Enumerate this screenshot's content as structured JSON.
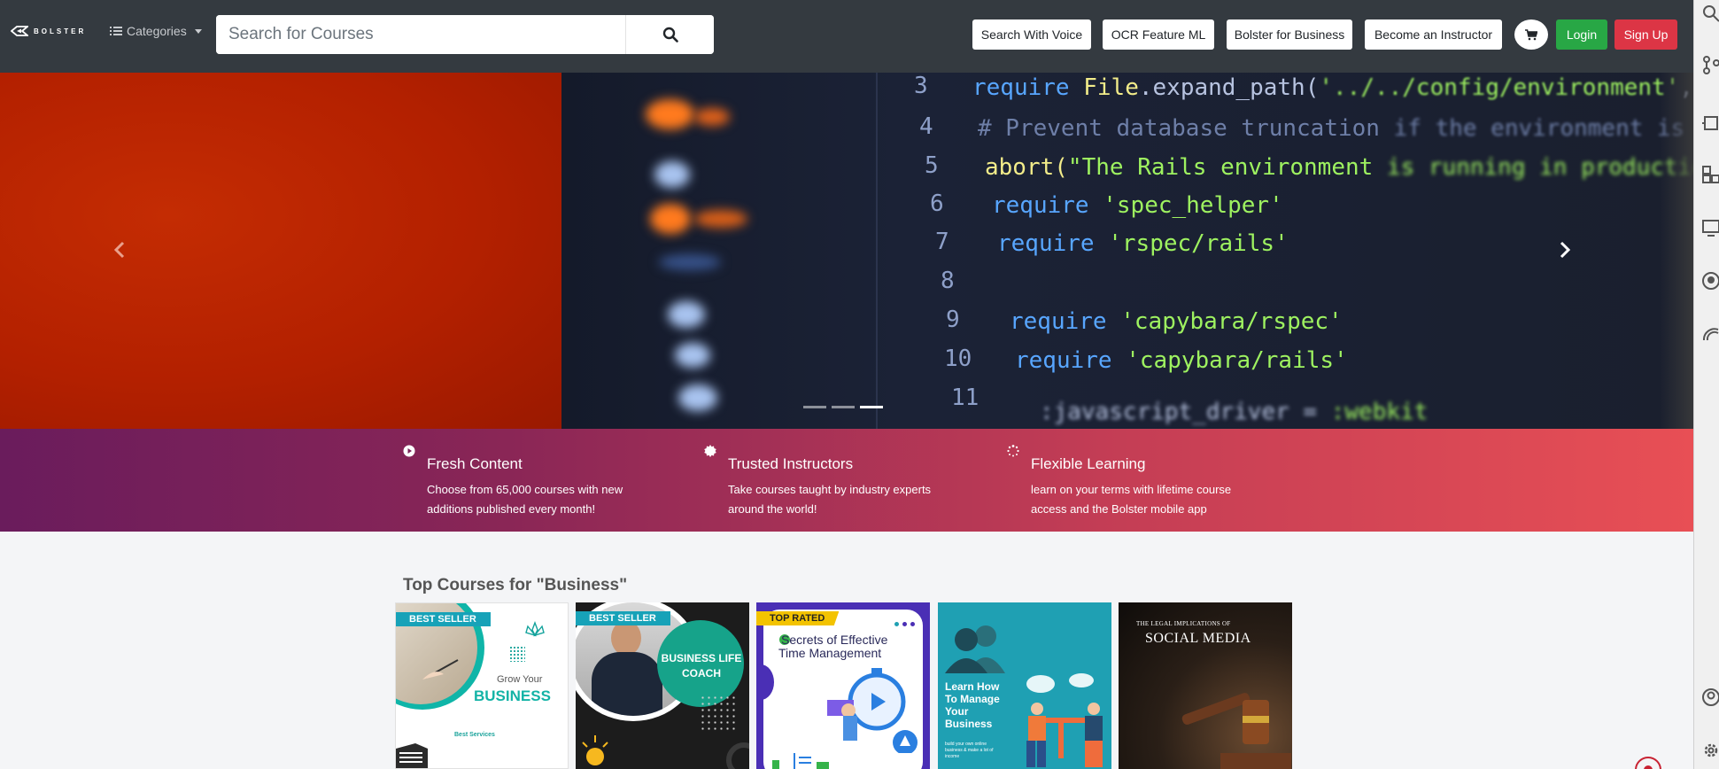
{
  "brand": {
    "name": "BOLSTER"
  },
  "navbar": {
    "categories_label": "Categories",
    "search_placeholder": "Search for Courses",
    "buttons": {
      "voice": "Search With Voice",
      "ocr": "OCR Feature ML",
      "business": "Bolster for Business",
      "instructor": "Become an Instructor",
      "login": "Login",
      "signup": "Sign Up"
    },
    "icons": {
      "categories": "list-icon",
      "search": "search-icon",
      "cart": "cart-icon"
    }
  },
  "hero": {
    "code_lines": [
      {
        "num": "3",
        "code": "require File.expand_path('../../config/environment', __FILE__)"
      },
      {
        "num": "4",
        "code": "# Prevent database truncation if the environment is production"
      },
      {
        "num": "5",
        "code": "abort(\"The Rails environment is running in production mode!\") if Rails.env.production?"
      },
      {
        "num": "6",
        "code": "require 'spec_helper'"
      },
      {
        "num": "7",
        "code": "require 'rspec/rails'"
      },
      {
        "num": "8",
        "code": ""
      },
      {
        "num": "9",
        "code": "require 'capybara/rspec'"
      },
      {
        "num": "10",
        "code": "require 'capybara/rails'"
      },
      {
        "num": "11",
        "code": ""
      }
    ],
    "slides_count": 3,
    "active_slide": 3
  },
  "features": [
    {
      "title": "Fresh Content",
      "description": "Choose from 65,000 courses with new additions published every month!",
      "icon": "play-circle-icon"
    },
    {
      "title": "Trusted Instructors",
      "description": "Take courses taught by industry experts around the world!",
      "icon": "certificate-icon"
    },
    {
      "title": "Flexible Learning",
      "description": "learn on your terms with lifetime course access and the Bolster mobile app",
      "icon": "spinner-icon"
    }
  ],
  "courses_section": {
    "title": "Top Courses for \"Business\"",
    "courses": [
      {
        "badge": "BEST SELLER",
        "line1": "Grow Your",
        "line2": "BUSINESS",
        "line3": "Best Services"
      },
      {
        "badge": "BEST SELLER",
        "line1": "BUSINESS LIFE",
        "line2": "COACH"
      },
      {
        "badge": "TOP RATED",
        "line1": "Secrets of Effective",
        "line2": "Time Management"
      },
      {
        "line1": "Learn How",
        "line2": "To Manage",
        "line3": "Your",
        "line4": "Business",
        "line5": "build your own online business & make a lot of income"
      },
      {
        "line1": "THE LEGAL IMPLICATIONS OF",
        "line2": "SOCIAL MEDIA"
      }
    ]
  },
  "colors": {
    "navbar": "#343a40",
    "login": "#28a745",
    "signup": "#dc3545",
    "badge_best": "#17a2b8",
    "badge_top": "#f3c300",
    "hero_red": "#b72200"
  }
}
